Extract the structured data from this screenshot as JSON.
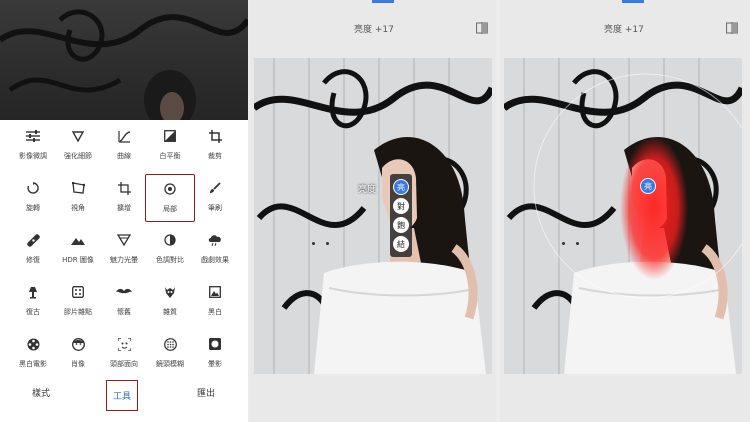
{
  "tools": [
    {
      "label": "影像微調",
      "icon": "tune-sliders-icon"
    },
    {
      "label": "強化細節",
      "icon": "triangle-details-icon"
    },
    {
      "label": "曲線",
      "icon": "curves-icon"
    },
    {
      "label": "白平衡",
      "icon": "white-balance-icon"
    },
    {
      "label": "裁剪",
      "icon": "crop-icon"
    },
    {
      "label": "旋轉",
      "icon": "rotate-icon"
    },
    {
      "label": "視角",
      "icon": "perspective-icon"
    },
    {
      "label": "擴增",
      "icon": "expand-icon"
    },
    {
      "label": "局部",
      "icon": "selective-target-icon"
    },
    {
      "label": "筆刷",
      "icon": "brush-icon"
    },
    {
      "label": "修復",
      "icon": "healing-bandage-icon"
    },
    {
      "label": "HDR 圖像",
      "icon": "mountains-icon"
    },
    {
      "label": "魅力光暈",
      "icon": "glamour-glow-icon"
    },
    {
      "label": "色調對比",
      "icon": "tonal-contrast-icon"
    },
    {
      "label": "戲劇效果",
      "icon": "drama-cloud-icon"
    },
    {
      "label": "復古",
      "icon": "vintage-lamp-icon"
    },
    {
      "label": "膠片雜點",
      "icon": "grainy-film-icon"
    },
    {
      "label": "懷舊",
      "icon": "mustache-icon"
    },
    {
      "label": "雜質",
      "icon": "grunge-icon"
    },
    {
      "label": "黑白",
      "icon": "black-white-icon"
    },
    {
      "label": "黑白電影",
      "icon": "film-reel-icon"
    },
    {
      "label": "肖像",
      "icon": "portrait-face-icon"
    },
    {
      "label": "頭部面向",
      "icon": "head-pose-icon"
    },
    {
      "label": "鏡頭模糊",
      "icon": "lens-blur-icon"
    },
    {
      "label": "暈影",
      "icon": "vignette-icon"
    }
  ],
  "bottom_nav": {
    "styles": "樣式",
    "tools": "工具",
    "export": "匯出"
  },
  "mid_editor": {
    "header": "亮度 +17",
    "pin_label": "亮度",
    "menu": [
      "亮",
      "對",
      "飽",
      "結"
    ]
  },
  "right_editor": {
    "header": "亮度 +17",
    "pin": "亮"
  },
  "colors": {
    "accent": "#3b7be0",
    "highlight_border": "#8b1d1d",
    "mask": "#ff2020"
  }
}
